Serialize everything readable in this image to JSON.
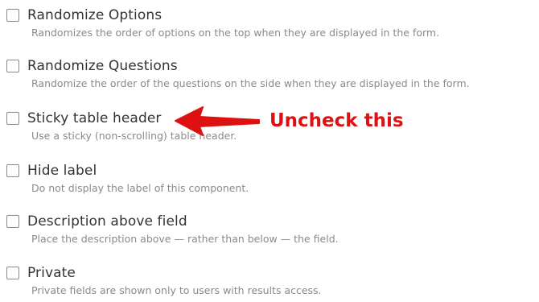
{
  "options": [
    {
      "label": "Randomize Options",
      "description": "Randomizes the order of options on the top when they are displayed in the form.",
      "checked": false
    },
    {
      "label": "Randomize Questions",
      "description": "Randomize the order of the questions on the side when they are displayed in the form.",
      "checked": false
    },
    {
      "label": "Sticky table header",
      "description": "Use a sticky (non-scrolling) table header.",
      "checked": false
    },
    {
      "label": "Hide label",
      "description": "Do not display the label of this component.",
      "checked": false
    },
    {
      "label": "Description above field",
      "description": "Place the description above — rather than below — the field.",
      "checked": false
    },
    {
      "label": "Private",
      "description": "Private fields are shown only to users with results access.",
      "checked": false
    }
  ],
  "annotation": {
    "text": "Uncheck this",
    "color": "#dd1111"
  }
}
